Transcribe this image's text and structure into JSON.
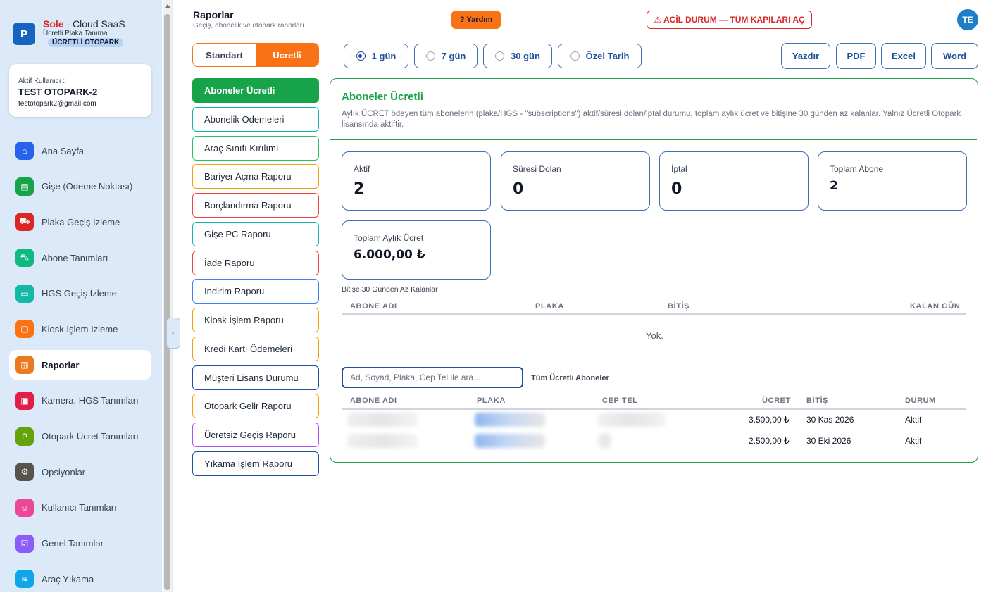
{
  "sidebar": {
    "brand": {
      "logo": "P",
      "name": "Sole",
      "name_suffix": " - Cloud SaaS",
      "subtitle": "Ücretli Plaka Tanıma",
      "badge": "ÜCRETLİ OTOPARK"
    },
    "user": {
      "label": "Aktif Kullanıcı :",
      "name": "TEST OTOPARK-2",
      "email": "testotopark2@gmail.com"
    },
    "items": [
      {
        "label": "Ana Sayfa",
        "icon": "home-icon",
        "color": "#2563eb"
      },
      {
        "label": "Gişe (Ödeme Noktası)",
        "icon": "cash-register-icon",
        "color": "#16a34a"
      },
      {
        "label": "Plaka Geçiş İzleme",
        "icon": "car-icon",
        "color": "#dc2626"
      },
      {
        "label": "Abone Tanımları",
        "icon": "car-front-icon",
        "color": "#10b981"
      },
      {
        "label": "HGS Geçiş İzleme",
        "icon": "card-icon",
        "color": "#14b8a6"
      },
      {
        "label": "Kiosk İşlem İzleme",
        "icon": "monitor-icon",
        "color": "#f97316"
      },
      {
        "label": "Raporlar",
        "icon": "bar-chart-icon",
        "color": "#ea7a1c"
      },
      {
        "label": "Kamera, HGS Tanımları",
        "icon": "chip-icon",
        "color": "#e11d48"
      },
      {
        "label": "Otopark Ücret Tanımları",
        "icon": "parking-icon",
        "color": "#65a30d"
      },
      {
        "label": "Opsiyonlar",
        "icon": "gear-icon",
        "color": "#57534e"
      },
      {
        "label": "Kullanıcı Tanımları",
        "icon": "users-icon",
        "color": "#ec4899"
      },
      {
        "label": "Genel Tanımlar",
        "icon": "checklist-icon",
        "color": "#8b5cf6"
      },
      {
        "label": "Araç Yıkama",
        "icon": "car-wash-icon",
        "color": "#0ea5e9"
      }
    ],
    "active_item": "Raporlar"
  },
  "header": {
    "title": "Raporlar",
    "subtitle": "Geçiş, abonelik ve otopark raporları",
    "help_label": "? Yardım",
    "emergency_label": "⚠ ACİL DURUM — TÜM KAPILARI AÇ",
    "avatar_initials": "TE"
  },
  "report_toggle": {
    "standard": "Standart",
    "paid": "Ücretli",
    "selected": "Ücretli"
  },
  "reports": [
    {
      "label": "Aboneler Ücretli",
      "border": "#16a34a",
      "active": true
    },
    {
      "label": "Abonelik Ödemeleri",
      "border": "#14b8a6"
    },
    {
      "label": "Araç Sınıfı Kırılımı",
      "border": "#22c55e"
    },
    {
      "label": "Bariyer Açma Raporu",
      "border": "#f59e0b"
    },
    {
      "label": "Borçlandırma Raporu",
      "border": "#ef4444"
    },
    {
      "label": "Gişe PC Raporu",
      "border": "#14b8a6"
    },
    {
      "label": "İade Raporu",
      "border": "#ef4444"
    },
    {
      "label": "İndirim Raporu",
      "border": "#3b82f6"
    },
    {
      "label": "Kiosk İşlem Raporu",
      "border": "#f59e0b"
    },
    {
      "label": "Kredi Kartı Ödemeleri",
      "border": "#f59e0b"
    },
    {
      "label": "Müşteri Lisans Durumu",
      "border": "#1d4f9a"
    },
    {
      "label": "Otopark Gelir Raporu",
      "border": "#f59e0b"
    },
    {
      "label": "Ücretsiz Geçiş Raporu",
      "border": "#a855f7"
    },
    {
      "label": "Yıkama İşlem Raporu",
      "border": "#1d4f9a"
    }
  ],
  "date_filters": [
    {
      "label": "1 gün",
      "selected": true
    },
    {
      "label": "7 gün",
      "selected": false
    },
    {
      "label": "30 gün",
      "selected": false
    },
    {
      "label": "Özel Tarih",
      "selected": false
    }
  ],
  "export": {
    "print": "Yazdır",
    "pdf": "PDF",
    "excel": "Excel",
    "word": "Word"
  },
  "panel": {
    "title": "Aboneler Ücretli",
    "description": "Aylık ÜCRET ödeyen tüm abonelerin (plaka/HGS - \"subscriptions\") aktif/süresi dolan/iptal durumu, toplam aylık ücret ve bitişine 30 günden az kalanlar. Yalnız Ücretli Otopark lisansında aktiftir.",
    "stats": {
      "active": {
        "label": "Aktif",
        "value": "2"
      },
      "expired": {
        "label": "Süresi Dolan",
        "value": "0"
      },
      "cancelled": {
        "label": "İptal",
        "value": "0"
      },
      "total": {
        "label": "Toplam Abone",
        "value": "2"
      },
      "monthly": {
        "label": "Toplam Aylık Ücret",
        "value": "6.000,00 ₺"
      }
    },
    "near_expiry": {
      "title": "Bitişe 30 Günden Az Kalanlar",
      "columns": [
        "ABONE ADI",
        "PLAKA",
        "BİTİŞ",
        "KALAN GÜN"
      ],
      "empty_text": "Yok."
    },
    "search": {
      "placeholder": "Ad, Soyad, Plaka, Cep Tel ile ara...",
      "value": ""
    },
    "all_label": "Tüm Ücretli Aboneler",
    "table": {
      "columns": [
        "ABONE ADI",
        "PLAKA",
        "CEP TEL",
        "ÜCRET",
        "BİTİŞ",
        "DURUM"
      ],
      "rows": [
        {
          "fee": "3.500,00 ₺",
          "end": "30 Kas 2026",
          "status": "Aktif"
        },
        {
          "fee": "2.500,00 ₺",
          "end": "30 Eki 2026",
          "status": "Aktif"
        }
      ]
    }
  }
}
